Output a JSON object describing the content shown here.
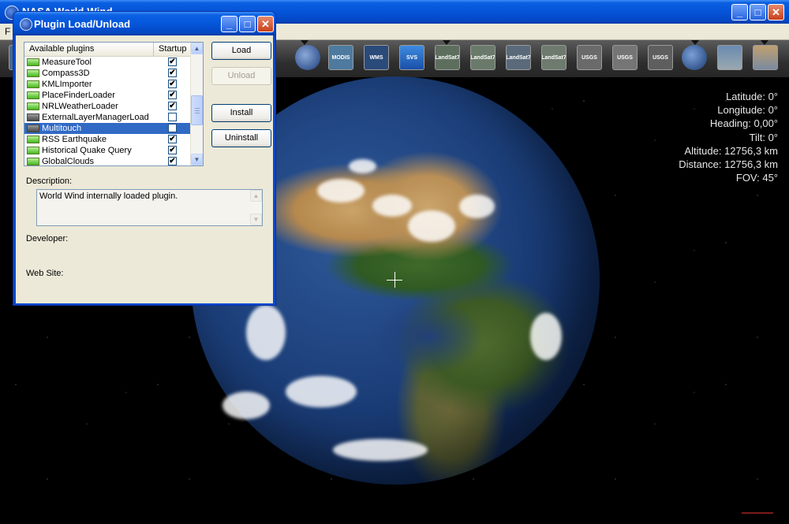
{
  "main": {
    "title": "NASA World Wind",
    "menu_first_letter": "F",
    "caption_buttons": {
      "minimize": "_",
      "maximize": "□",
      "close": "✕"
    }
  },
  "toolbar": {
    "items": [
      {
        "name": "tb-landsat-icon",
        "text": ""
      },
      {
        "name": "tb-blue-marble-button",
        "text": ""
      },
      {
        "name": "tb-modis-button",
        "text": "MODIS"
      },
      {
        "name": "tb-wms-button",
        "text": "WMS"
      },
      {
        "name": "tb-svs-button",
        "text": "SVS"
      },
      {
        "name": "tb-landsat7-visible-button",
        "text": "LandSat7"
      },
      {
        "name": "tb-landsat7-pseudo-button",
        "text": "LandSat7"
      },
      {
        "name": "tb-landsat7-pseudo2-button",
        "text": "LandSat7"
      },
      {
        "name": "tb-landsat7-pseudo3-button",
        "text": "LandSat7"
      },
      {
        "name": "tb-usgs-urban-button",
        "text": "USGS"
      },
      {
        "name": "tb-usgs-topo-button",
        "text": "USGS"
      },
      {
        "name": "tb-usgs-ortho-button",
        "text": "USGS"
      },
      {
        "name": "tb-globe-button",
        "text": ""
      },
      {
        "name": "tb-map-button",
        "text": ""
      },
      {
        "name": "tb-places-button",
        "text": ""
      }
    ]
  },
  "view_info": {
    "latitude": "Latitude: 0°",
    "longitude": "Longitude: 0°",
    "heading": "Heading: 0,00°",
    "tilt": "Tilt: 0°",
    "altitude": "Altitude: 12756,3 km",
    "distance": "Distance: 12756,3 km",
    "fov": "FOV: 45°"
  },
  "dialog": {
    "title": "Plugin Load/Unload",
    "columns": {
      "available": "Available plugins",
      "startup": "Startup"
    },
    "plugins": [
      {
        "name": "MeasureTool",
        "startup": "✔",
        "loaded": true
      },
      {
        "name": "Compass3D",
        "startup": "✔",
        "loaded": true
      },
      {
        "name": "KMLImporter",
        "startup": "✔",
        "loaded": true
      },
      {
        "name": "PlaceFinderLoader",
        "startup": "✔",
        "loaded": true
      },
      {
        "name": "NRLWeatherLoader",
        "startup": "✔",
        "loaded": true
      },
      {
        "name": "ExternalLayerManagerLoad",
        "startup": "",
        "loaded": false
      },
      {
        "name": "Multitouch",
        "startup": "",
        "loaded": false,
        "selected": true
      },
      {
        "name": "RSS Earthquake",
        "startup": "✔",
        "loaded": true
      },
      {
        "name": "Historical Quake Query",
        "startup": "✔",
        "loaded": true
      },
      {
        "name": "GlobalClouds",
        "startup": "✔",
        "loaded": true
      }
    ],
    "buttons": {
      "load": "Load",
      "unload": "Unload",
      "install": "Install",
      "uninstall": "Uninstall"
    },
    "description_label": "Description:",
    "description_text": "World Wind internally loaded plugin.",
    "developer_label": "Developer:",
    "website_label": "Web Site:",
    "scroll_up": "▲",
    "scroll_down": "▼"
  }
}
